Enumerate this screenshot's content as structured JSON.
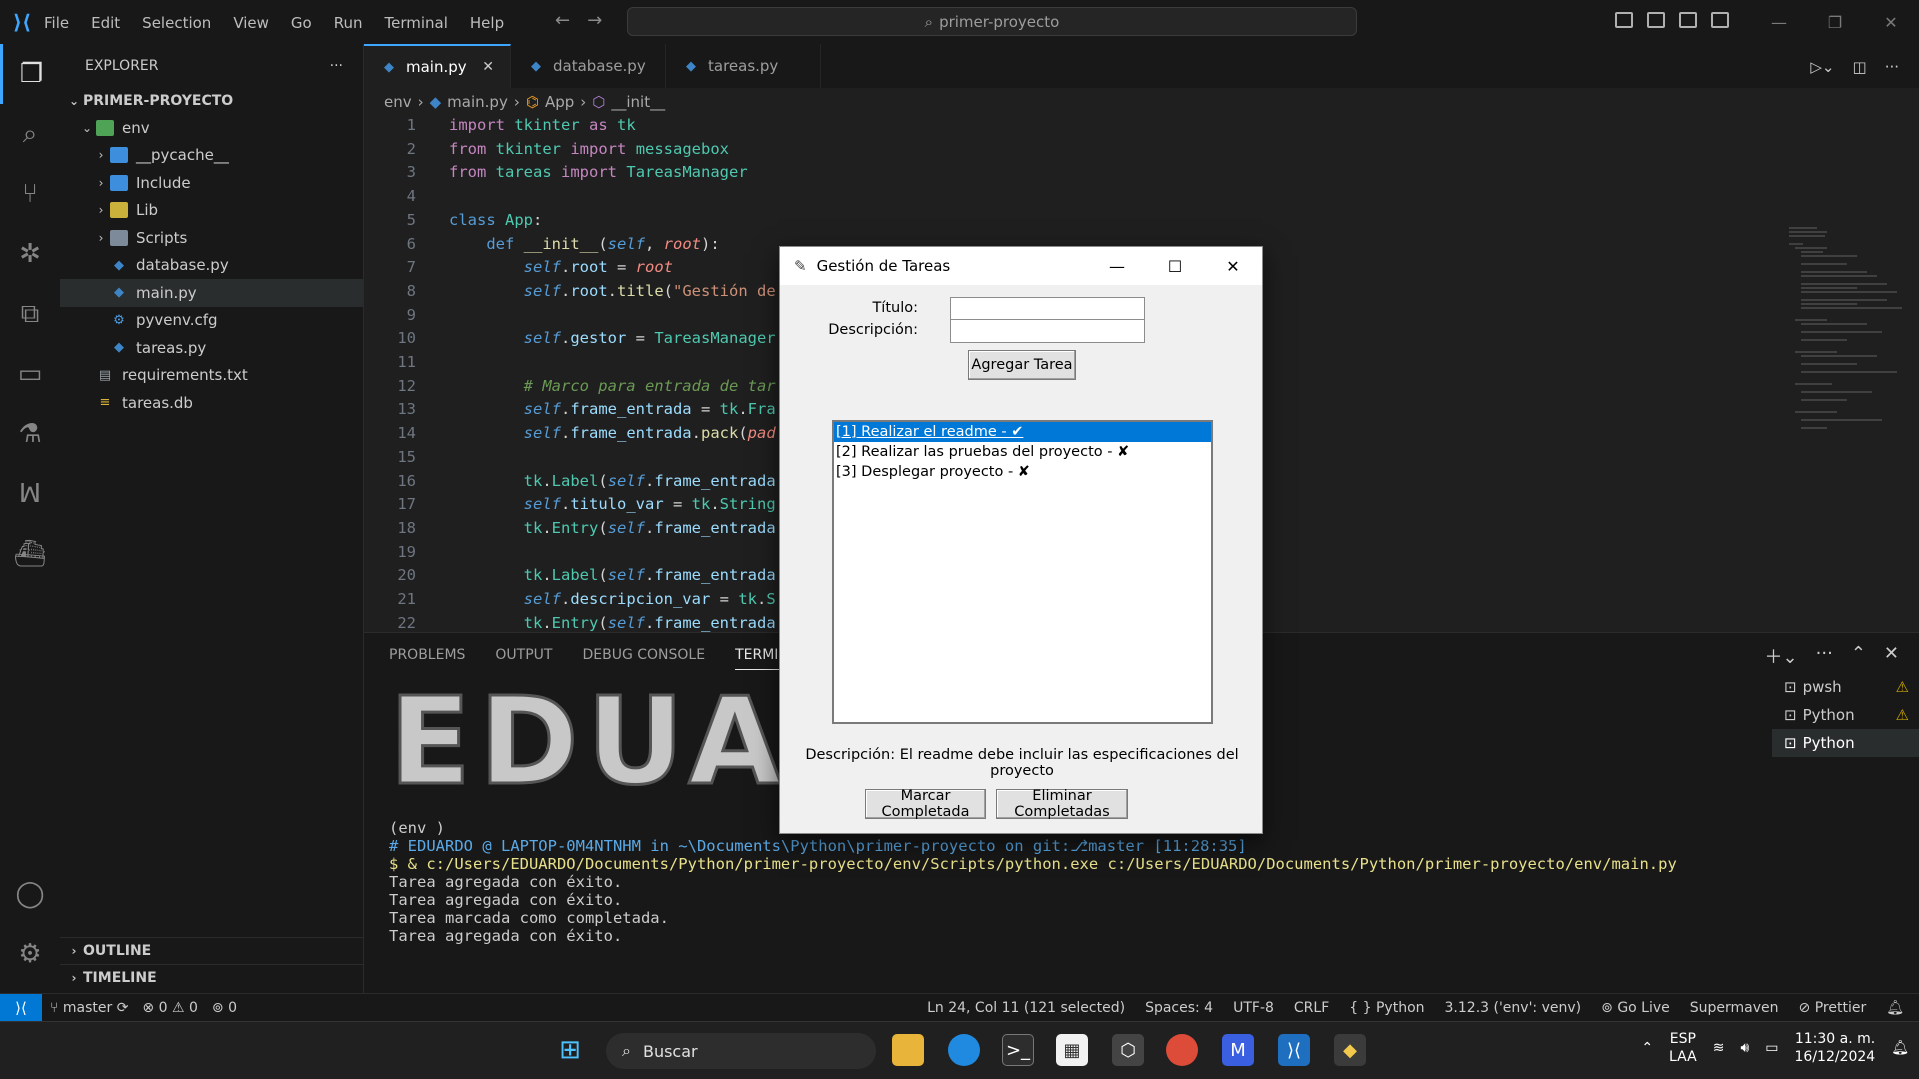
{
  "titlebar": {
    "menu": [
      "File",
      "Edit",
      "Selection",
      "View",
      "Go",
      "Run",
      "Terminal",
      "Help"
    ],
    "search": "primer-proyecto"
  },
  "explorer": {
    "header": "EXPLORER",
    "more": "···",
    "project": "PRIMER-PROYECTO",
    "items": [
      {
        "label": "env",
        "icon": "folder-env-icon",
        "depth": 1,
        "open": true
      },
      {
        "label": "__pycache__",
        "icon": "folder-icon",
        "depth": 2
      },
      {
        "label": "Include",
        "icon": "folder-icon",
        "depth": 2
      },
      {
        "label": "Lib",
        "icon": "folder-lib-icon",
        "depth": 2
      },
      {
        "label": "Scripts",
        "icon": "folder-scripts-icon",
        "depth": 2
      },
      {
        "label": "database.py",
        "icon": "python-icon",
        "depth": 2
      },
      {
        "label": "main.py",
        "icon": "python-icon",
        "depth": 2,
        "selected": true
      },
      {
        "label": "pyvenv.cfg",
        "icon": "gear-icon",
        "depth": 2
      },
      {
        "label": "tareas.py",
        "icon": "python-icon",
        "depth": 2
      },
      {
        "label": "requirements.txt",
        "icon": "file-icon",
        "depth": 1
      },
      {
        "label": "tareas.db",
        "icon": "database-icon",
        "depth": 1
      }
    ],
    "outline": "OUTLINE",
    "timeline": "TIMELINE"
  },
  "tabs": [
    {
      "label": "main.py",
      "active": true
    },
    {
      "label": "database.py"
    },
    {
      "label": "tareas.py"
    }
  ],
  "breadcrumb": [
    "env",
    "main.py",
    "App",
    "__init__"
  ],
  "code_lines": [
    "1",
    "2",
    "3",
    "4",
    "5",
    "6",
    "7",
    "8",
    "9",
    "10",
    "11",
    "12",
    "13",
    "14",
    "15",
    "16",
    "17",
    "18",
    "19",
    "20",
    "21",
    "22"
  ],
  "panel": {
    "tabs": [
      "PROBLEMS",
      "OUTPUT",
      "DEBUG CONSOLE",
      "TERMINAL"
    ],
    "terminals": [
      "pwsh",
      "Python",
      "Python"
    ],
    "banner": "EDUARD",
    "lines": [
      "(env )",
      "# EDUARDO @ LAPTOP-0M4NTNHM in ~\\Documents\\Python\\primer-proyecto on git:⎇master [11:28:35]",
      "$ & c:/Users/EDUARDO/Documents/Python/primer-proyecto/env/Scripts/python.exe c:/Users/EDUARDO/Documents/Python/primer-proyecto/env/main.py",
      "Tarea agregada con éxito.",
      "Tarea agregada con éxito.",
      "Tarea marcada como completada.",
      "Tarea agregada con éxito."
    ]
  },
  "statusbar": {
    "branch": "master",
    "errors": "0",
    "warnings": "0",
    "ports": "0",
    "position": "Ln 24, Col 11 (121 selected)",
    "spaces": "Spaces: 4",
    "encoding": "UTF-8",
    "eol": "CRLF",
    "language": "Python",
    "interpreter": "3.12.3 ('env': venv)",
    "golive": "Go Live",
    "supermaven": "Supermaven",
    "prettier": "Prettier"
  },
  "taskbar": {
    "search": "Buscar",
    "lang": "ESP",
    "layout": "LAA",
    "time": "11:30 a. m.",
    "date": "16/12/2024"
  },
  "dialog": {
    "title": "Gestión de Tareas",
    "titulo_label": "Título:",
    "descripcion_label": "Descripción:",
    "titulo_value": "",
    "descripcion_value": "",
    "add_button": "Agregar Tarea",
    "tasks": [
      {
        "text": "[1] Realizar el readme - ✔",
        "selected": true
      },
      {
        "text": "[2] Realizar las pruebas del proyecto - ✘"
      },
      {
        "text": "[3] Desplegar proyecto - ✘"
      }
    ],
    "description": "Descripción: El readme debe incluir las especificaciones del proyecto",
    "mark_button": "Marcar Completada",
    "delete_button": "Eliminar Completadas"
  }
}
